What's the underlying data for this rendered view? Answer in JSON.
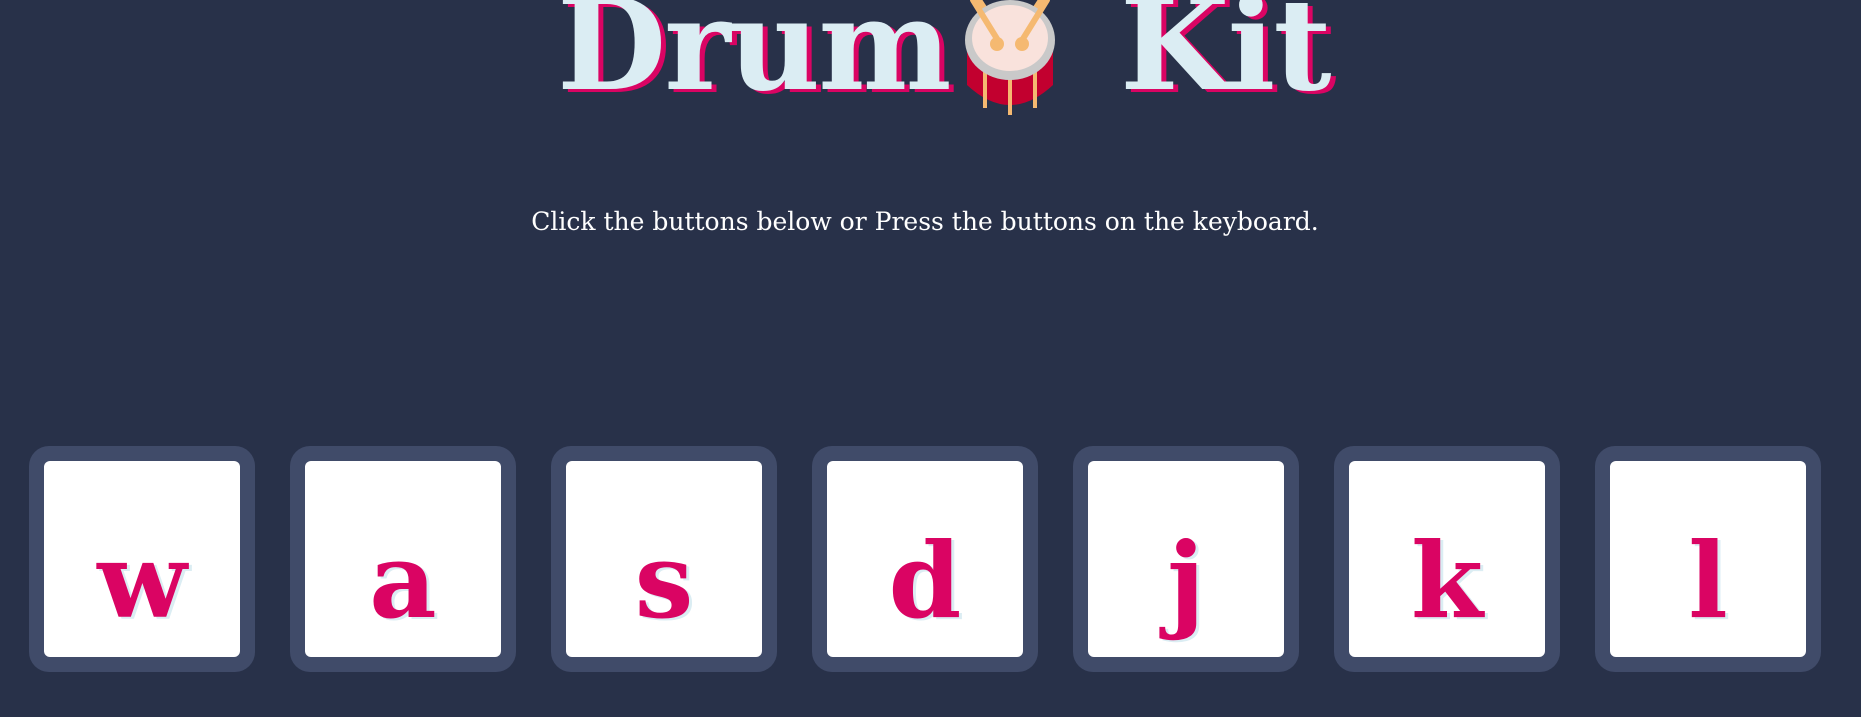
{
  "header": {
    "title_part1": "Drum",
    "title_part2": "Kit",
    "emoji_icon": "drum-icon"
  },
  "instructions": "Click the buttons below or Press the buttons on the keyboard.",
  "colors": {
    "background": "#283149",
    "title": "#dbedf3",
    "accent": "#da0463",
    "key_border": "#404b69",
    "key_face": "#ffffff"
  },
  "keys": [
    {
      "label": "w"
    },
    {
      "label": "a"
    },
    {
      "label": "s"
    },
    {
      "label": "d"
    },
    {
      "label": "j"
    },
    {
      "label": "k"
    },
    {
      "label": "l"
    }
  ]
}
